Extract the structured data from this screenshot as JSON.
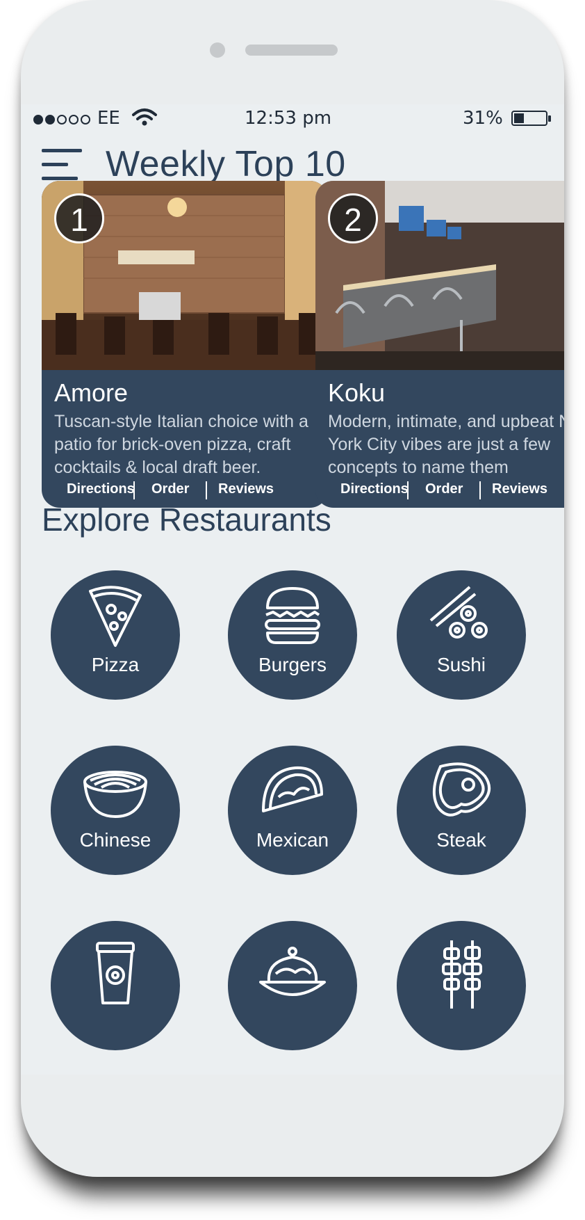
{
  "status_bar": {
    "carrier": "EE",
    "time": "12:53  pm",
    "battery": "31%",
    "battery_level": 0.31,
    "signal_bars_filled": 2,
    "signal_bars_total": 5
  },
  "header": {
    "title": "Weekly Top 10"
  },
  "top10": [
    {
      "rank": "1",
      "name": "Amore",
      "description": "Tuscan-style Italian choice with a patio for brick-oven pizza, craft cocktails & local draft beer.",
      "actions": [
        "Directions",
        "Order",
        "Reviews"
      ]
    },
    {
      "rank": "2",
      "name": "Koku",
      "description": "Modern, intimate, and upbeat New York City vibes are just a few concepts to name them",
      "actions": [
        "Directions",
        "Order",
        "Reviews"
      ]
    }
  ],
  "explore": {
    "title": "Explore Restaurants",
    "categories": [
      {
        "label": "Pizza",
        "icon": "pizza-icon"
      },
      {
        "label": "Burgers",
        "icon": "burger-icon"
      },
      {
        "label": "Sushi",
        "icon": "sushi-icon"
      },
      {
        "label": "Chinese",
        "icon": "noodle-bowl-icon"
      },
      {
        "label": "Mexican",
        "icon": "taco-icon"
      },
      {
        "label": "Steak",
        "icon": "steak-icon"
      },
      {
        "label": "",
        "icon": "coffee-cup-icon"
      },
      {
        "label": "",
        "icon": "pasta-plate-icon"
      },
      {
        "label": "",
        "icon": "skewer-icon"
      }
    ]
  },
  "colors": {
    "primary": "#33475e",
    "title_text": "#2c4159",
    "background": "#ebeff1"
  }
}
